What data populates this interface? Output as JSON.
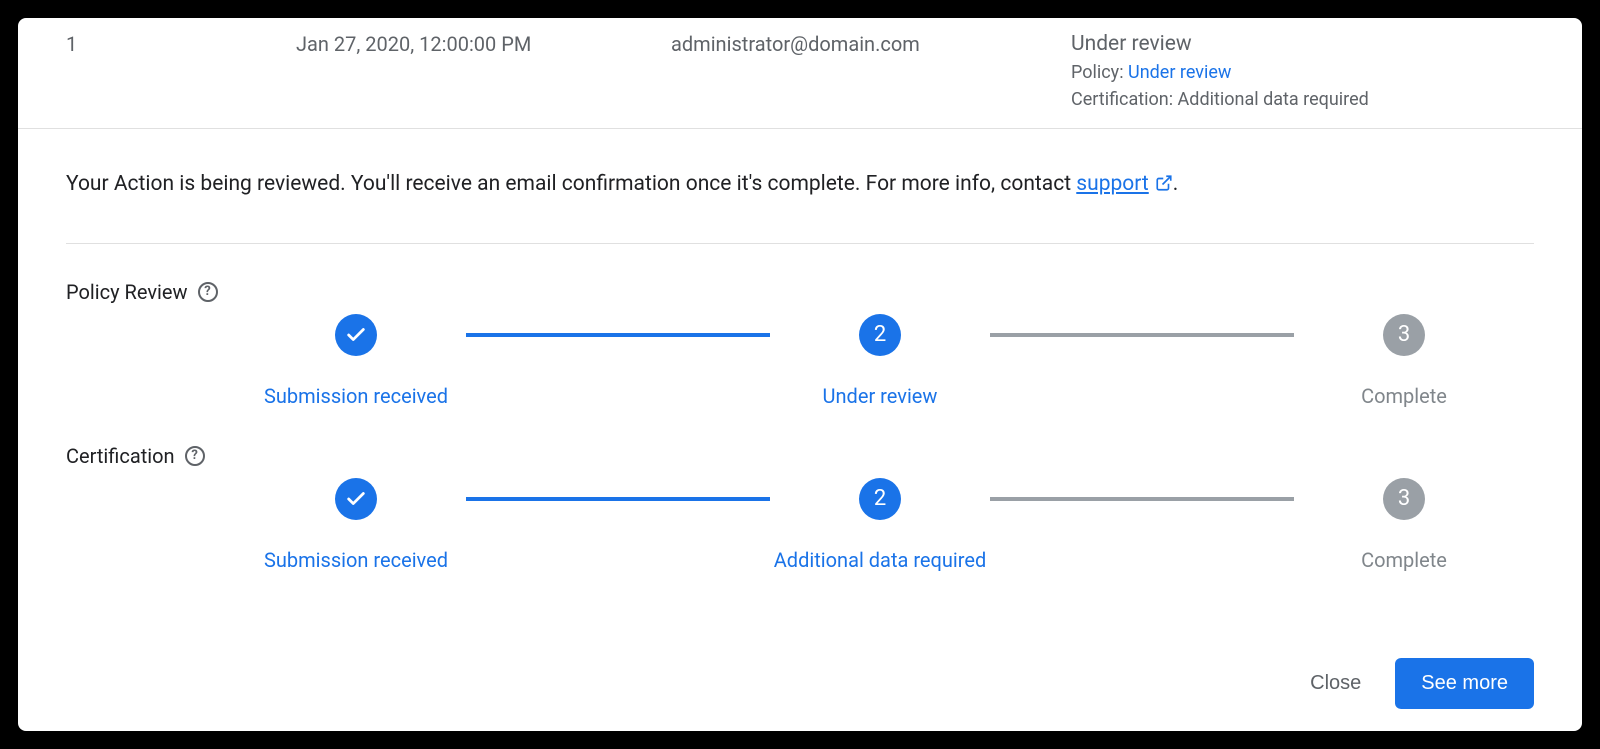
{
  "row": {
    "index": "1",
    "date": "Jan 27, 2020, 12:00:00 PM",
    "email": "administrator@domain.com",
    "status_title": "Under review",
    "policy_label": "Policy: ",
    "policy_status": "Under review",
    "cert_label": "Certification: Additional data required"
  },
  "message": {
    "text_before": "Your Action is being reviewed. You'll receive an email confirmation once it's complete. For more info, contact ",
    "link_text": "support",
    "text_after": "."
  },
  "sections": {
    "policy": {
      "title": "Policy Review",
      "steps": [
        "Submission received",
        "Under review",
        "Complete"
      ]
    },
    "certification": {
      "title": "Certification",
      "steps": [
        "Submission received",
        "Additional data required",
        "Complete"
      ]
    }
  },
  "step_numbers": {
    "two": "2",
    "three": "3"
  },
  "help_glyph": "?",
  "buttons": {
    "close": "Close",
    "see_more": "See more"
  }
}
